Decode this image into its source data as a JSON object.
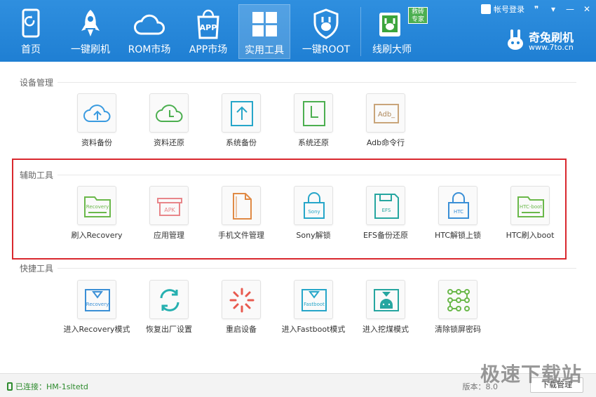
{
  "nav": [
    {
      "label": "首页",
      "icon": "phone-home-icon"
    },
    {
      "label": "一键刷机",
      "icon": "rocket-icon"
    },
    {
      "label": "ROM市场",
      "icon": "cloud-icon"
    },
    {
      "label": "APP市场",
      "icon": "app-bag-icon"
    },
    {
      "label": "实用工具",
      "icon": "grid-icon",
      "active": true
    },
    {
      "label": "一键ROOT",
      "icon": "root-shield-icon"
    },
    {
      "label": "线刷大师",
      "icon": "line-flash-icon",
      "badge": "救砖专家"
    }
  ],
  "topbar": {
    "login": "帐号登录"
  },
  "brand": {
    "name": "奇兔刷机",
    "url": "www.7to.cn"
  },
  "sections": {
    "device": {
      "title": "设备管理",
      "items": [
        "资料备份",
        "资料还原",
        "系统备份",
        "系统还原",
        "Adb命令行"
      ]
    },
    "aux": {
      "title": "辅助工具",
      "items": [
        "刷入Recovery",
        "应用管理",
        "手机文件管理",
        "Sony解锁",
        "EFS备份还原",
        "HTC解锁上锁",
        "HTC刷入boot"
      ],
      "icon_text": [
        "Recovery",
        "APK",
        "",
        "Sony",
        "EFS",
        "HTC",
        "HTC-boot"
      ]
    },
    "quick": {
      "title": "快捷工具",
      "items": [
        "进入Recovery模式",
        "恢复出厂设置",
        "重启设备",
        "进入Fastboot模式",
        "进入挖煤模式",
        "清除锁屏密码"
      ],
      "icon_text": [
        "Recovery",
        "",
        "",
        "Fastboot",
        "",
        ""
      ]
    }
  },
  "device_icon_text": {
    "adb": "Adb_"
  },
  "status": {
    "connected": "已连接：HM-1sltetd",
    "version": "版本：8.0",
    "download": "下载管理"
  },
  "watermark": "极速下载站",
  "colors": {
    "header": "#2185d8",
    "highlight": "#d9282e",
    "green": "#4caf50",
    "orange": "#e07b39"
  }
}
